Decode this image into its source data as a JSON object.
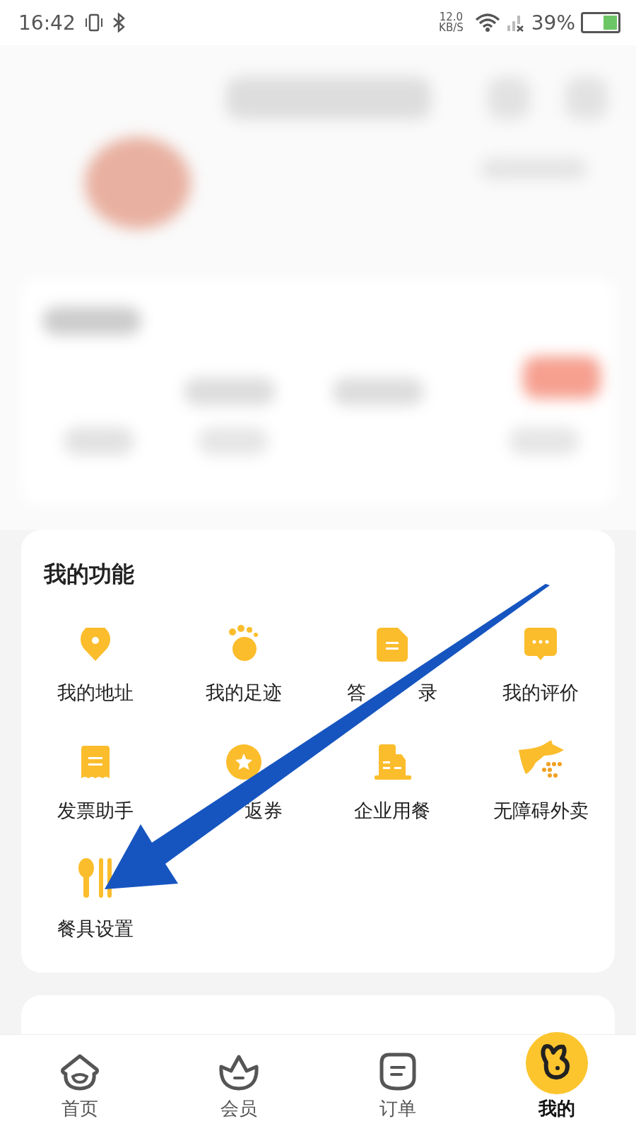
{
  "status_bar": {
    "time": "16:42",
    "net_speed": "12.0",
    "net_unit": "KB/S",
    "battery": "39%"
  },
  "functions": {
    "title": "我的功能",
    "items": [
      {
        "kind": "pin",
        "labels": [
          "我的地址"
        ]
      },
      {
        "kind": "paw",
        "labels": [
          "我的足迹"
        ]
      },
      {
        "kind": "doc",
        "labels": [
          "答",
          "录"
        ]
      },
      {
        "kind": "chat",
        "labels": [
          "我的评价"
        ]
      },
      {
        "kind": "receipt",
        "labels": [
          "发票助手"
        ]
      },
      {
        "kind": "coupon",
        "labels": [
          "返券"
        ]
      },
      {
        "kind": "building",
        "labels": [
          "企业用餐"
        ]
      },
      {
        "kind": "access",
        "labels": [
          "无障碍外卖"
        ]
      },
      {
        "kind": "cutlery",
        "labels": [
          "餐具设置"
        ]
      }
    ]
  },
  "nav": [
    {
      "kind": "home",
      "label": "首页",
      "selected": false
    },
    {
      "kind": "member",
      "label": "会员",
      "selected": false
    },
    {
      "kind": "order",
      "label": "订单",
      "selected": false
    },
    {
      "kind": "mine",
      "label": "我的",
      "selected": true
    }
  ]
}
